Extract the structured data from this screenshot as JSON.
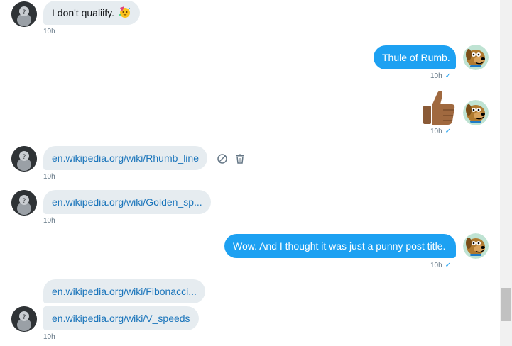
{
  "messages": [
    {
      "text": "I don't qualiify.",
      "emoji": "party-face",
      "time": "10h"
    },
    {
      "text": "Thule of Rumb.",
      "time": "10h",
      "check": "✓"
    },
    {
      "emoji": "thumbs-up",
      "time": "10h",
      "check": "✓"
    },
    {
      "text": "en.wikipedia.org/wiki/Rhumb_line",
      "time": "10h"
    },
    {
      "text": "en.wikipedia.org/wiki/Golden_sp...",
      "time": "10h"
    },
    {
      "text": "Wow. And I thought it was just a punny post title.",
      "time": "10h",
      "check": "✓"
    },
    {
      "text": "en.wikipedia.org/wiki/Fibonacci...",
      "time": ""
    },
    {
      "text": "en.wikipedia.org/wiki/V_speeds",
      "time": "10h"
    }
  ],
  "actions": {
    "block_icon": "block-icon",
    "delete_icon": "trash-icon"
  },
  "avatars": {
    "other": "anonymous-user-icon",
    "self": "cartoon-dog-icon"
  },
  "colors": {
    "outgoing": "#1da1f2",
    "incoming": "#e6ecf0",
    "link": "#1b75bb",
    "timestamp": "#657786"
  }
}
